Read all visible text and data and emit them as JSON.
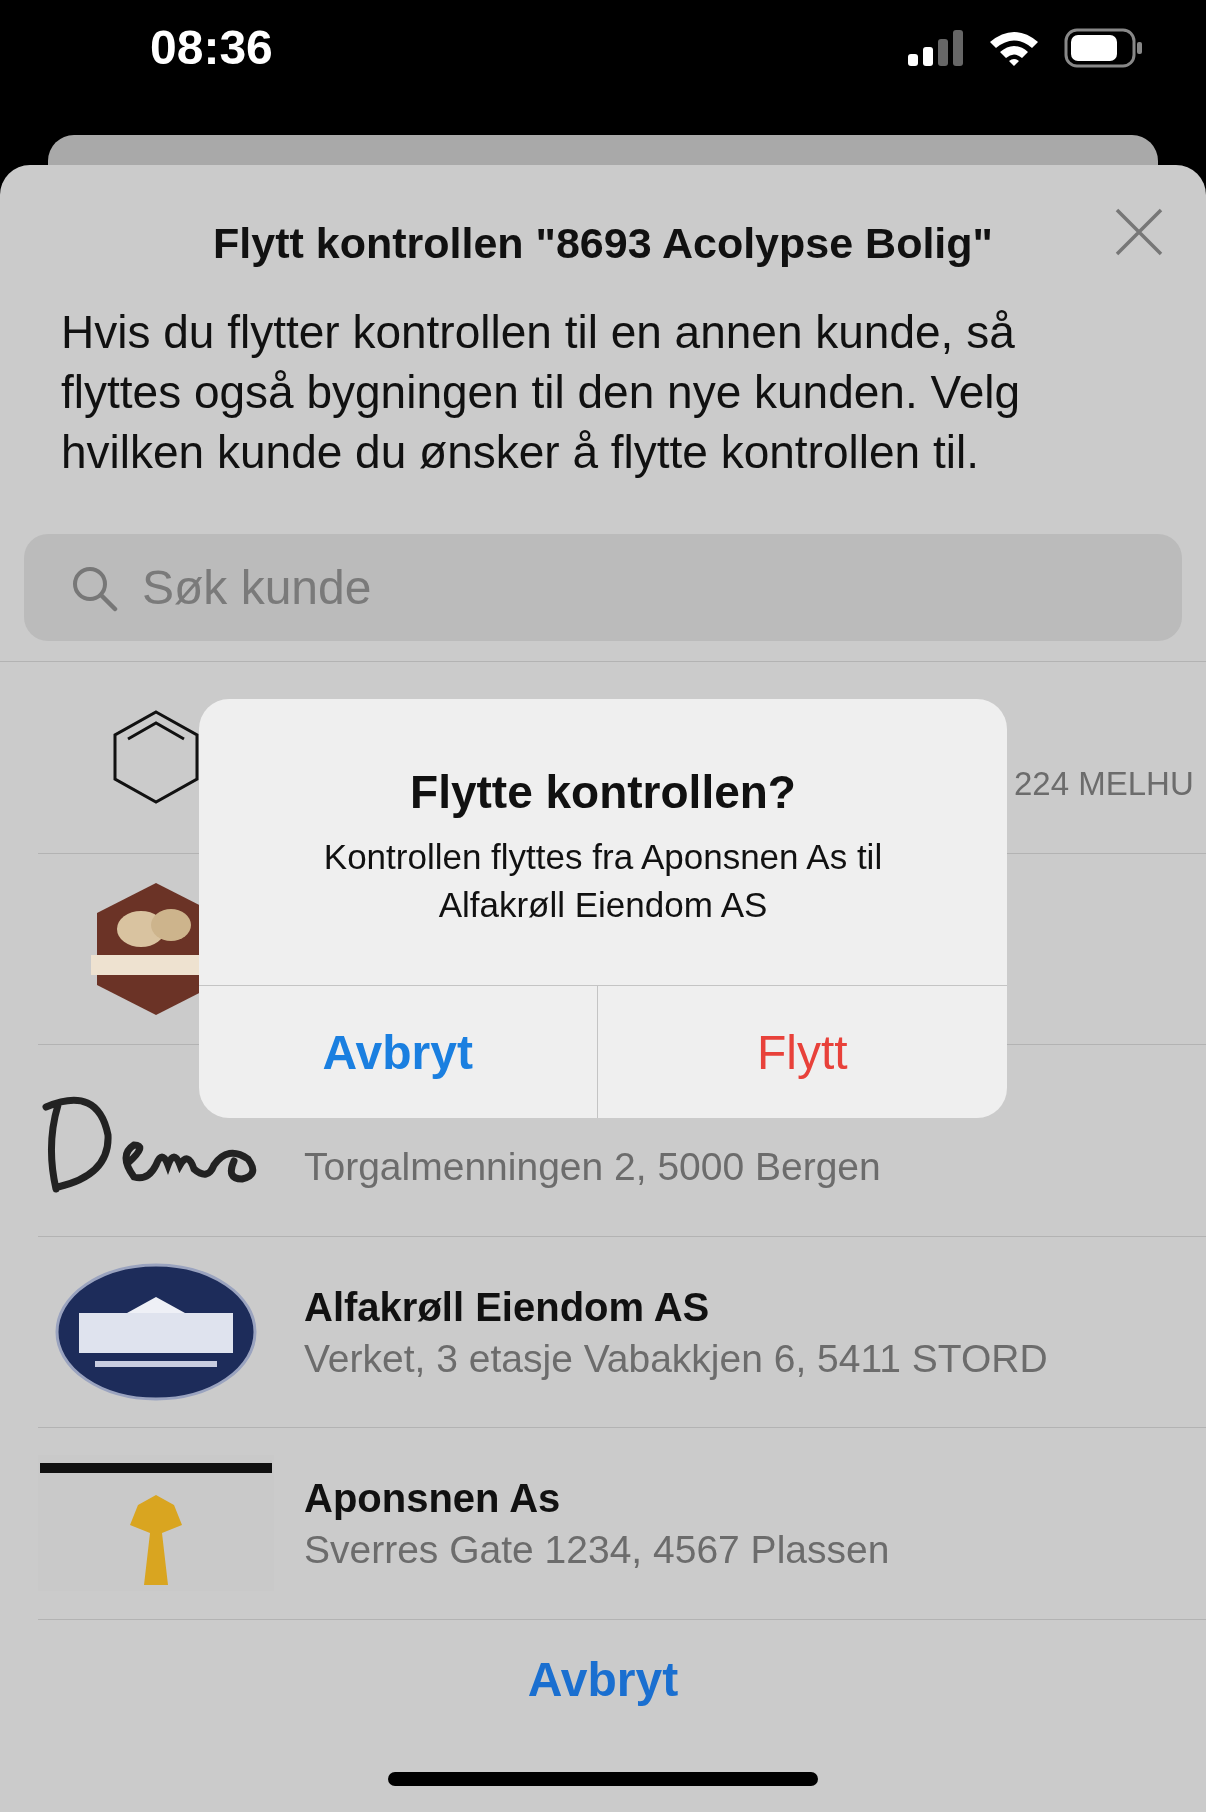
{
  "status_bar": {
    "time": "08:36"
  },
  "sheet": {
    "title": "Flytt kontrollen \"8693 Acolypse Bolig\"",
    "description": "Hvis du flytter kontrollen til en annen kunde, så flyttes også bygningen til den nye kunden. Velg hvilken kunde du ønsker å flytte kontrollen til.",
    "search": {
      "placeholder": "Søk kunde"
    },
    "customers": [
      {
        "kind": "hexagon",
        "address": "224 MELHU",
        "covered": true
      },
      {
        "kind": "crest"
      },
      {
        "kind": "script",
        "address": "Torgalmenningen 2, 5000 Bergen"
      },
      {
        "kind": "oval",
        "name": "Alfakrøll Eiendom AS",
        "address": "Verket, 3 etasje Vabakkjen 6, 5411 STORD"
      },
      {
        "kind": "wheat",
        "name": "Aponsnen As",
        "address": "Sverres Gate 1234, 4567 Plassen"
      }
    ],
    "cancel": "Avbryt"
  },
  "alert": {
    "title": "Flytte kontrollen?",
    "message": "Kontrollen flyttes fra Aponsnen As til Alfakrøll Eiendom AS",
    "actions": [
      {
        "label": "Avbryt",
        "kind": "cancel"
      },
      {
        "label": "Flytt",
        "kind": "destructive"
      }
    ]
  }
}
